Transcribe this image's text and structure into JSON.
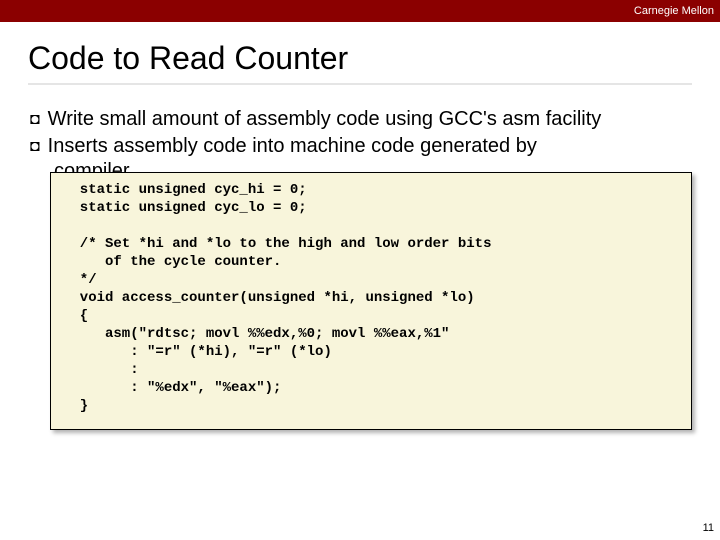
{
  "header": {
    "brand": "Carnegie Mellon"
  },
  "title": "Code to Read Counter",
  "bullets": [
    "Write small amount of assembly code using GCC's asm facility",
    "Inserts assembly code into machine code generated by"
  ],
  "bullet_partial": "compiler",
  "code": "  static unsigned cyc_hi = 0;\n  static unsigned cyc_lo = 0;\n\n  /* Set *hi and *lo to the high and low order bits\n     of the cycle counter.\n  */\n  void access_counter(unsigned *hi, unsigned *lo)\n  {\n     asm(\"rdtsc; movl %%edx,%0; movl %%eax,%1\"\n        : \"=r\" (*hi), \"=r\" (*lo)\n        :\n        : \"%edx\", \"%eax\");\n  }",
  "page_number": "11"
}
